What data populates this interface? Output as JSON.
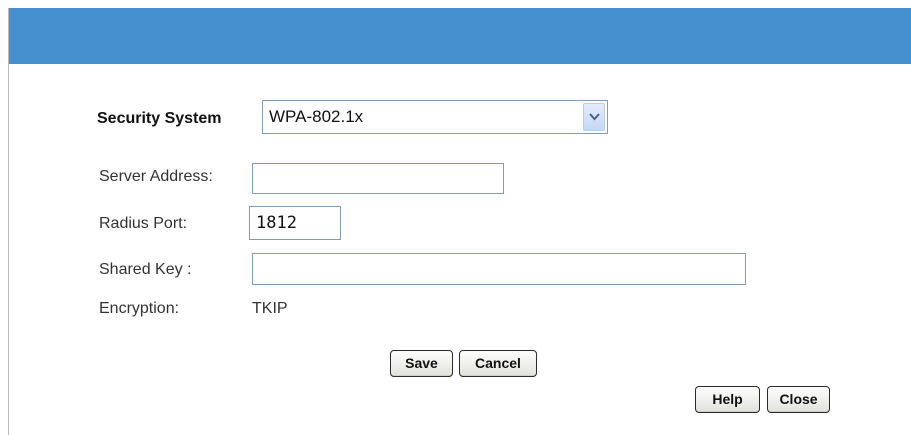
{
  "header": {
    "banner_color": "#4590cf"
  },
  "security": {
    "label": "Security System",
    "selected": "WPA-802.1x",
    "arrow_icon": "chevron-down-icon"
  },
  "server": {
    "label": "Server Address:",
    "value": ""
  },
  "radius": {
    "label": "Radius Port:",
    "value": "1812"
  },
  "shared_key": {
    "label": "Shared Key :",
    "value": ""
  },
  "encryption": {
    "label": "Encryption:",
    "value": "TKIP"
  },
  "buttons": {
    "save": "Save",
    "cancel": "Cancel",
    "help": "Help",
    "close": "Close"
  }
}
